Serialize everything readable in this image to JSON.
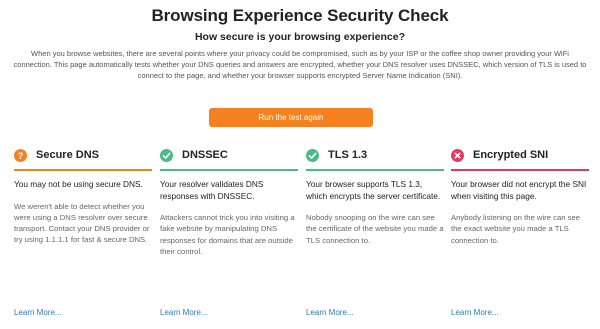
{
  "page": {
    "title": "Browsing Experience Security Check",
    "subtitle": "How secure is your browsing experience?",
    "intro": "When you browse websites, there are several points where your privacy could be compromised, such as by your ISP or the coffee shop owner providing your WiFi connection. This page automatically tests whether your DNS queries and answers are encrypted, whether your DNS resolver uses DNSSEC, which version of TLS is used to connect to the page, and whether your browser supports encrypted Server Name Indication (SNI).",
    "run_button": "Run the test again"
  },
  "cards": [
    {
      "title": "Secure DNS",
      "status": "warning",
      "icon": "question-icon",
      "color": "#f6821f",
      "lead": "You may not be using secure DNS.",
      "body": "We weren't able to detect whether you were using a DNS resolver over secure transport. Contact your DNS provider or try using 1.1.1.1 for fast & secure DNS.",
      "link": "Learn More..."
    },
    {
      "title": "DNSSEC",
      "status": "success",
      "icon": "check-icon",
      "color": "#4cb98a",
      "lead": "Your resolver validates DNS responses with DNSSEC.",
      "body": "Attackers cannot trick you into visiting a fake website by manipulating DNS responses for domains that are outside their control.",
      "link": "Learn More..."
    },
    {
      "title": "TLS 1.3",
      "status": "success",
      "icon": "check-icon",
      "color": "#4cb98a",
      "lead": "Your browser supports TLS 1.3, which encrypts the server certificate.",
      "body": "Nobody snooping on the wire can see the certificate of the website you made a TLS connection to.",
      "link": "Learn More..."
    },
    {
      "title": "Encrypted SNI",
      "status": "failure",
      "icon": "x-icon",
      "color": "#e23b62",
      "lead": "Your browser did not encrypt the SNI when visiting this page.",
      "body": "Anybody listening on the wire can see the exact website you made a TLS connection to.",
      "link": "Learn More..."
    }
  ]
}
